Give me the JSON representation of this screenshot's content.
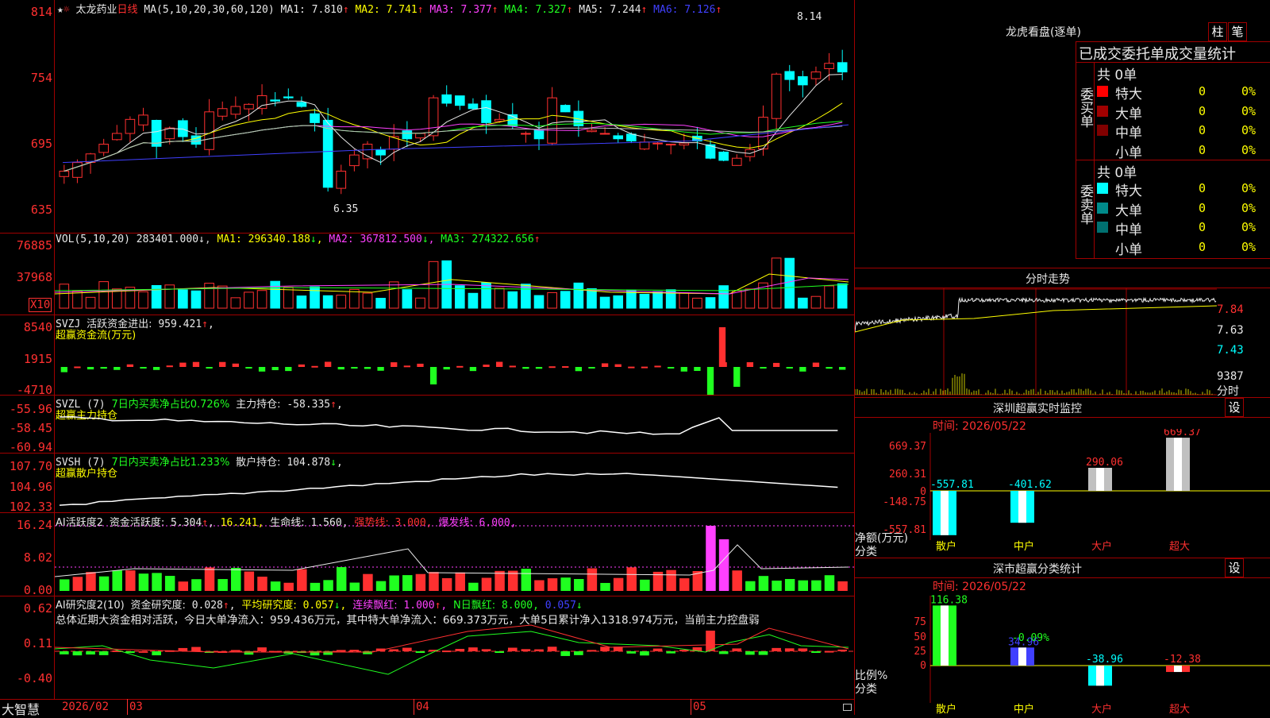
{
  "main": {
    "name": "太龙药业",
    "period": "日线",
    "ma_label": "MA(5,10,20,30,60,120)",
    "ma": [
      {
        "label": "MA1:",
        "value": "7.810",
        "arrow": "↑",
        "color": "#e8e8e8"
      },
      {
        "label": "MA2:",
        "value": "7.741",
        "arrow": "↑",
        "color": "#ffff00"
      },
      {
        "label": "MA3:",
        "value": "7.377",
        "arrow": "↑",
        "color": "#ff40ff"
      },
      {
        "label": "MA4:",
        "value": "7.327",
        "arrow": "↑",
        "color": "#20ff20"
      },
      {
        "label": "MA5:",
        "value": "7.244",
        "arrow": "↑",
        "color": "#e8e8e8"
      },
      {
        "label": "MA6:",
        "value": "7.126",
        "arrow": "↑",
        "color": "#4040ff"
      }
    ],
    "y_ticks": [
      "814",
      "754",
      "695",
      "635"
    ],
    "high_label": "8.14",
    "low_label": "6.35"
  },
  "vol": {
    "label": "VOL(5,10,20)",
    "value": "283401.000",
    "value_arrow": "↓",
    "ma": [
      {
        "label": "MA1:",
        "value": "296340.188",
        "arrow": "↓",
        "color": "#ffff00"
      },
      {
        "label": "MA2:",
        "value": "367812.500",
        "arrow": "↓",
        "color": "#ff40ff"
      },
      {
        "label": "MA3:",
        "value": "274322.656",
        "arrow": "↑",
        "color": "#20ff20"
      }
    ],
    "y_ticks": [
      "76885",
      "37968"
    ],
    "unit": "X10"
  },
  "svzj": {
    "label": "SVZJ",
    "text": "活跃资金进出:",
    "value": "959.421",
    "arrow": "↑",
    "sub": "超赢资金流(万元)",
    "y_ticks": [
      "8540",
      "1915",
      "-4710"
    ]
  },
  "svzl": {
    "label": "SVZL (7)",
    "green_text": "7日内买卖净占比0.726%",
    "text": "主力持仓:",
    "value": "-58.335",
    "arrow": "↑",
    "sub": "超赢主力持仓",
    "y_ticks": [
      "-55.96",
      "-58.45",
      "-60.94"
    ]
  },
  "svsh": {
    "label": "SVSH (7)",
    "green_text": "7日内买卖净占比1.233%",
    "text": "散户持仓:",
    "value": "104.878",
    "arrow": "↓",
    "sub": "超赢散户持仓",
    "y_ticks": [
      "107.70",
      "104.96",
      "102.33"
    ]
  },
  "ai1": {
    "label": "AI活跃度2",
    "t1": "资金活跃度:",
    "v1": "5.304",
    "a1": "↑",
    "v2": "16.241",
    "a2": "",
    "t3": "生命线:",
    "v3": "1.560",
    "t4": "强势线:",
    "v4": "3.000",
    "t5": "爆发线:",
    "v5": "6.000",
    "y_ticks": [
      "16.24",
      "8.02",
      "0.00"
    ]
  },
  "ai2": {
    "label": "AI研究度2(10)",
    "t1": "资金研究度:",
    "v1": "0.028",
    "a1": "↑",
    "t2": "平均研究度:",
    "v2": "0.057",
    "a2": "↓",
    "t3": "连续飘红:",
    "v3": "1.000",
    "a3": "↑",
    "t4": "N日飘红:",
    "v4": "8.000",
    "v5": "0.057",
    "a5": "↓",
    "summary": "总体近期大资金相对活跃，今日大单净流入：959.436万元，其中特大单净流入：669.373万元，大单5日累计净入1318.974万元，当前主力控盘弱",
    "y_ticks": [
      "0.62",
      "0.11",
      "-0.40"
    ]
  },
  "footer": {
    "brand": "大智慧",
    "date1": "2026/02",
    "m1": "03",
    "m2": "04",
    "m3": "05"
  },
  "right": {
    "title": "龙虎看盘(逐单)",
    "btn1": "柱",
    "btn2": "笔",
    "subtitle": "已成交委托单成交量统计",
    "buy": {
      "side": "委买单",
      "total": "共 0单",
      "rows": [
        {
          "name": "特大",
          "count": "0",
          "pct": "0%",
          "color": "#ff0000"
        },
        {
          "name": "大单",
          "count": "0",
          "pct": "0%",
          "color": "#a00000"
        },
        {
          "name": "中单",
          "count": "0",
          "pct": "0%",
          "color": "#800000"
        },
        {
          "name": "小单",
          "count": "0",
          "pct": "0%",
          "color": ""
        }
      ]
    },
    "sell": {
      "side": "委卖单",
      "total": "共 0单",
      "rows": [
        {
          "name": "特大",
          "count": "0",
          "pct": "0%",
          "color": "#00ffff"
        },
        {
          "name": "大单",
          "count": "0",
          "pct": "0%",
          "color": "#008a8a"
        },
        {
          "name": "中单",
          "count": "0",
          "pct": "0%",
          "color": "#007070"
        },
        {
          "name": "小单",
          "count": "0",
          "pct": "0%",
          "color": ""
        }
      ]
    },
    "intraday": {
      "title": "分时走势",
      "prices": [
        "7.84",
        "7.63",
        "7.43"
      ],
      "vol": "9387",
      "vol_label": "分时"
    },
    "sz_monitor": {
      "title": "深圳超赢实时监控",
      "btn": "设",
      "time_label": "时间: 2026/05/22",
      "y_ticks": [
        "669.37",
        "260.31",
        "0",
        "-148.75",
        "-557.81"
      ],
      "ylabel1": "净额(万元)",
      "ylabel2": "分类",
      "categories": [
        "散户",
        "中户",
        "大户",
        "超大"
      ],
      "values": [
        -557.81,
        -401.62,
        290.06,
        669.37
      ],
      "value_labels": [
        "-557.81",
        "-401.62",
        "290.06",
        "669.37"
      ]
    },
    "sz_class": {
      "title": "深市超赢分类统计",
      "btn": "设",
      "time_label": "时间: 2026/05/22",
      "y_ticks": [
        "75",
        "50",
        "25",
        "0"
      ],
      "ylabel1": "比例%",
      "ylabel2": "分类",
      "categories": [
        "散户",
        "中户",
        "大户",
        "超大"
      ],
      "values": [
        116.38,
        34.96,
        -38.96,
        -12.38
      ],
      "value_labels": [
        "116.38",
        "34.96",
        "-38.96",
        "-12.38"
      ],
      "mid_label": "-0.09%"
    }
  }
}
